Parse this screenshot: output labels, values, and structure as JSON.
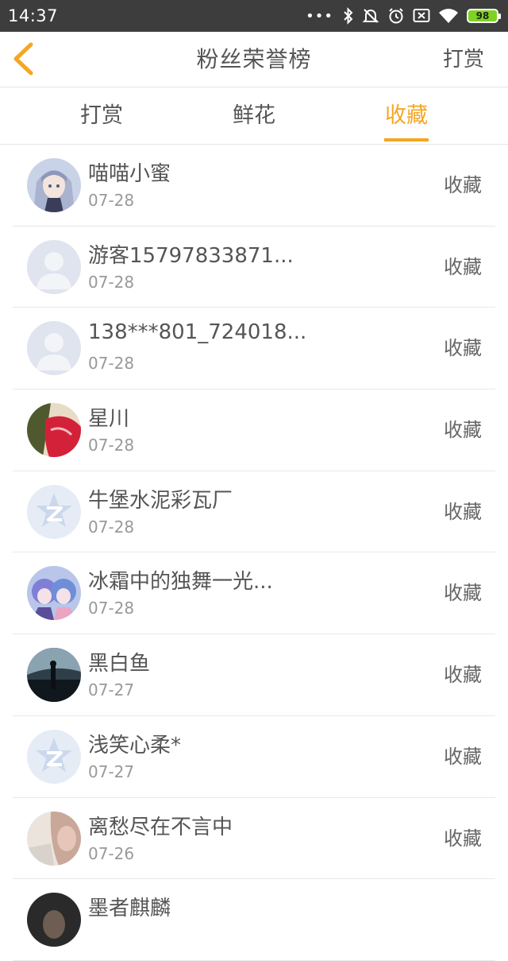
{
  "status_bar": {
    "time": "14:37",
    "battery": "98"
  },
  "header": {
    "title": "粉丝荣誉榜",
    "action_label": "打赏"
  },
  "tabs": [
    {
      "label": "打赏"
    },
    {
      "label": "鲜花"
    },
    {
      "label": "收藏",
      "active": true
    }
  ],
  "fans": [
    {
      "name": "喵喵小蜜",
      "date": "07-28",
      "action": "收藏",
      "avatar": "anime-girl-avatar"
    },
    {
      "name": "游客15797833871...",
      "date": "07-28",
      "action": "收藏",
      "avatar": "default-user-avatar"
    },
    {
      "name": "138***801_724018...",
      "date": "07-28",
      "action": "收藏",
      "avatar": "default-user-avatar"
    },
    {
      "name": "星川",
      "date": "07-28",
      "action": "收藏",
      "avatar": "photo-avatar"
    },
    {
      "name": "牛堡水泥彩瓦厂",
      "date": "07-28",
      "action": "收藏",
      "avatar": "qzone-star-avatar"
    },
    {
      "name": "冰霜中的独舞一光...",
      "date": "07-28",
      "action": "收藏",
      "avatar": "anime-duo-avatar"
    },
    {
      "name": "黑白鱼",
      "date": "07-27",
      "action": "收藏",
      "avatar": "dark-scene-avatar"
    },
    {
      "name": "浅笑心柔*",
      "date": "07-27",
      "action": "收藏",
      "avatar": "qzone-star-avatar"
    },
    {
      "name": "离愁尽在不言中",
      "date": "07-26",
      "action": "收藏",
      "avatar": "portrait-avatar"
    },
    {
      "name": "墨者麒麟",
      "date": "",
      "action": "",
      "avatar": "dark-portrait-avatar"
    }
  ],
  "colors": {
    "accent": "#f5a623",
    "status_bar": "#3d3d3d",
    "battery": "#7ed321"
  }
}
